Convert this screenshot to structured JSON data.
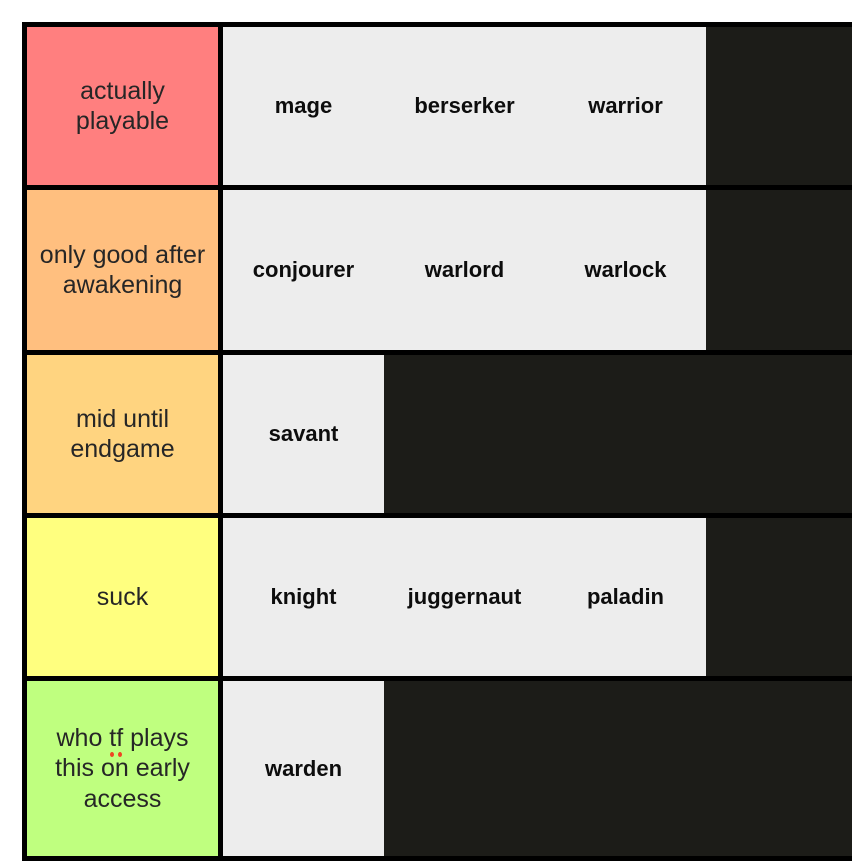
{
  "tierlist": {
    "rows": [
      {
        "label": "actually playable",
        "color": "#FF7F7F",
        "items": [
          "mage",
          "berserker",
          "warrior"
        ]
      },
      {
        "label": "only good after awakening",
        "color": "#FFBF7F",
        "items": [
          "conjourer",
          "warlord",
          "warlock"
        ]
      },
      {
        "label": "mid until endgame",
        "color": "#FFD480",
        "items": [
          "savant"
        ]
      },
      {
        "label": "suck",
        "color": "#FFFF7F",
        "items": [
          "knight",
          "juggernaut",
          "paladin"
        ]
      },
      {
        "label_prefix": "who ",
        "label_misspelled": "tf",
        "label_suffix": " plays this on early access",
        "color": "#BFFF7F",
        "items": [
          "warden"
        ]
      }
    ],
    "colors": {
      "border": "#000000",
      "item_panel": "#EDEDED",
      "empty_area": "#1C1C18",
      "label_text": "#262626",
      "item_text": "#0D0D0D",
      "spellcheck": "#EF4423"
    }
  }
}
